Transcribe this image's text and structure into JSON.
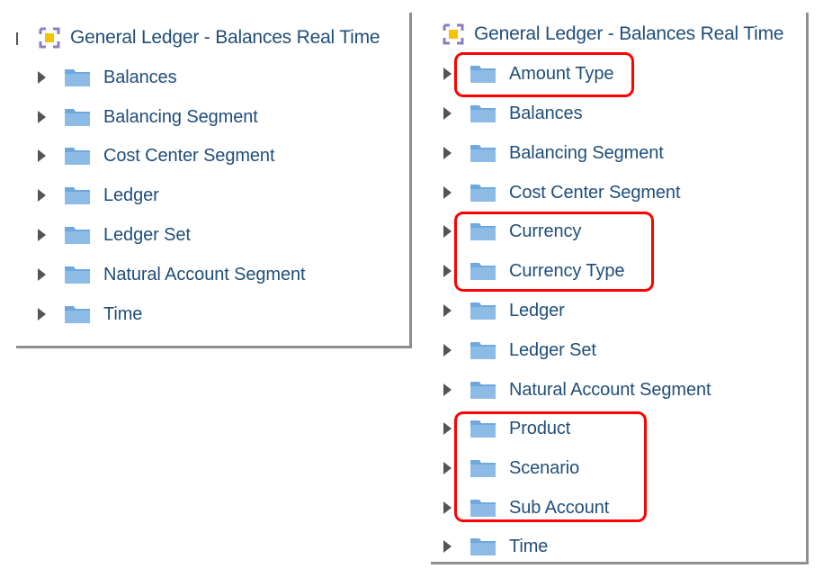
{
  "left_panel": {
    "title": "General Ledger - Balances Real Time",
    "items": [
      {
        "label": "Balances"
      },
      {
        "label": "Balancing Segment"
      },
      {
        "label": "Cost Center Segment"
      },
      {
        "label": "Ledger"
      },
      {
        "label": "Ledger Set"
      },
      {
        "label": "Natural Account Segment"
      },
      {
        "label": "Time"
      }
    ]
  },
  "right_panel": {
    "title": "General Ledger - Balances Real Time",
    "items": [
      {
        "label": "Amount Type",
        "highlighted": true
      },
      {
        "label": "Balances",
        "highlighted": false
      },
      {
        "label": "Balancing Segment",
        "highlighted": false
      },
      {
        "label": "Cost Center Segment",
        "highlighted": false
      },
      {
        "label": "Currency",
        "highlighted": true
      },
      {
        "label": "Currency Type",
        "highlighted": true
      },
      {
        "label": "Ledger",
        "highlighted": false
      },
      {
        "label": "Ledger Set",
        "highlighted": false
      },
      {
        "label": "Natural Account Segment",
        "highlighted": false
      },
      {
        "label": "Product",
        "highlighted": true
      },
      {
        "label": "Scenario",
        "highlighted": true
      },
      {
        "label": "Sub Account",
        "highlighted": true
      },
      {
        "label": "Time",
        "highlighted": false
      }
    ]
  },
  "colors": {
    "label_text": "#1f4e79",
    "folder": "#6fa8dc",
    "highlight_border": "#ff0000",
    "expand_arrow": "#555555"
  },
  "icons": {
    "subject_area": "subject-area-cube-icon",
    "folder": "folder-icon",
    "expand": "expand-arrow-icon"
  }
}
